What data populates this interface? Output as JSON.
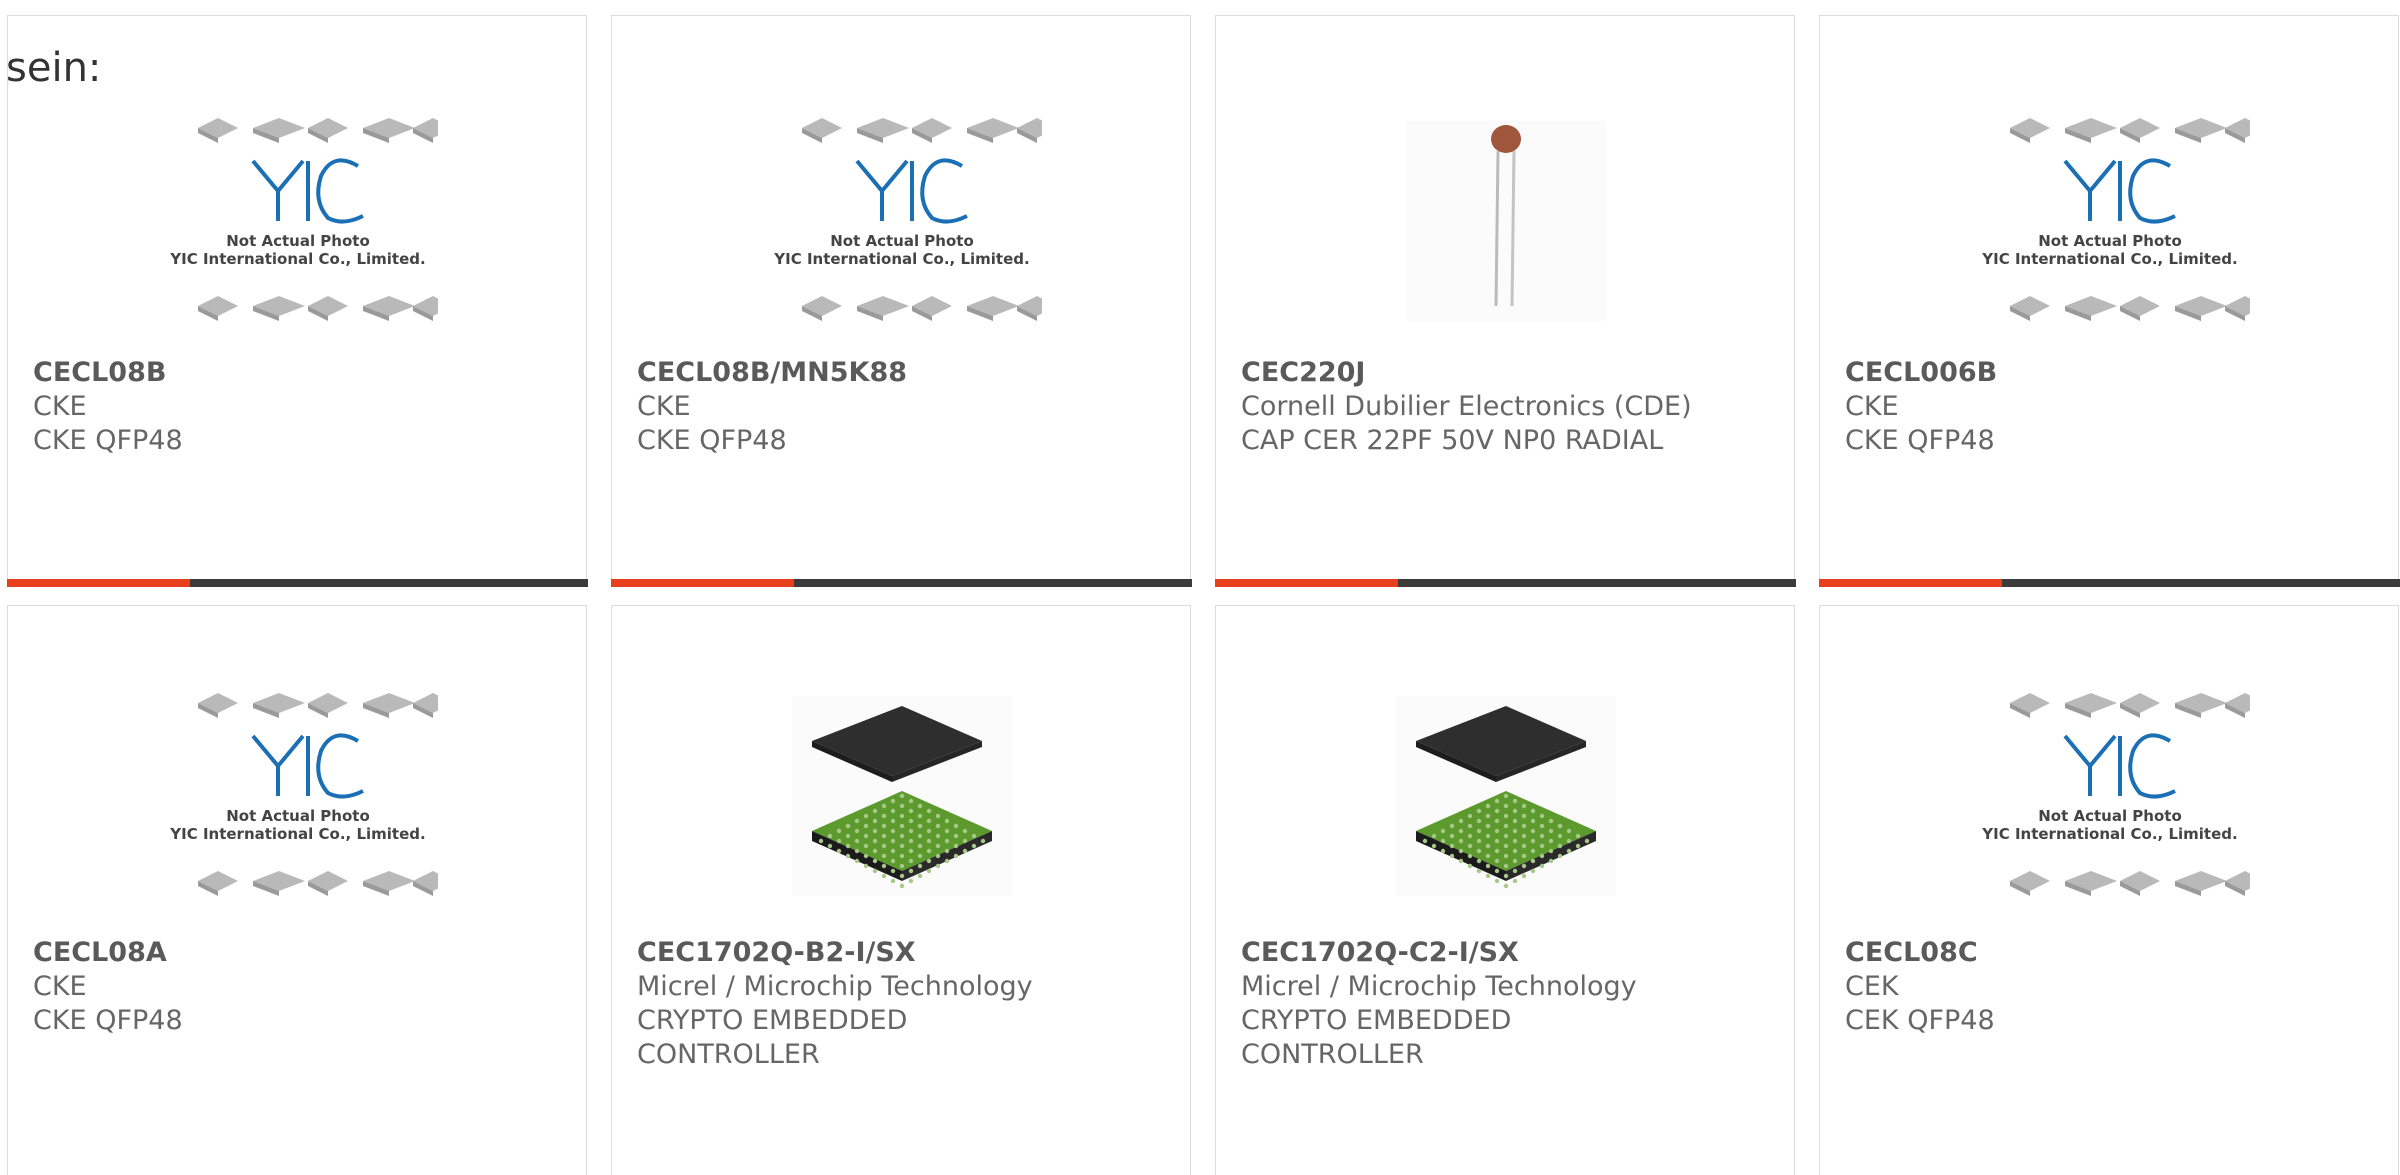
{
  "intro_text": "sein:",
  "colors": {
    "accent": "#e8401c",
    "bar": "#3b3b3b",
    "border": "#dcdcdc",
    "text": "#666666",
    "yic_blue": "#1a6fb5",
    "chip_green": "#5d9a2e"
  },
  "placeholder": {
    "line1": "Not Actual Photo",
    "line2": "YIC International Co., Limited."
  },
  "products": [
    {
      "part_number": "CECL08B",
      "manufacturer": "CKE",
      "description": "CKE QFP48",
      "image": "yic-placeholder"
    },
    {
      "part_number": "CECL08B/MN5K88",
      "manufacturer": "CKE",
      "description": "CKE QFP48",
      "image": "yic-placeholder"
    },
    {
      "part_number": "CEC220J",
      "manufacturer": "Cornell Dubilier Electronics (CDE)",
      "description": "CAP CER 22PF 50V NP0 RADIAL",
      "image": "ceramic-capacitor"
    },
    {
      "part_number": "CECL006B",
      "manufacturer": "CKE",
      "description": "CKE QFP48",
      "image": "yic-placeholder"
    },
    {
      "part_number": "CECL08A",
      "manufacturer": "CKE",
      "description": "CKE QFP48",
      "image": "yic-placeholder"
    },
    {
      "part_number": "CEC1702Q-B2-I/SX",
      "manufacturer": "Micrel / Microchip Technology",
      "description": "CRYPTO EMBEDDED CONTROLLER",
      "image": "bga-chip"
    },
    {
      "part_number": "CEC1702Q-C2-I/SX",
      "manufacturer": "Micrel / Microchip Technology",
      "description": "CRYPTO EMBEDDED CONTROLLER",
      "image": "bga-chip"
    },
    {
      "part_number": "CECL08C",
      "manufacturer": "CEK",
      "description": "CEK QFP48",
      "image": "yic-placeholder"
    }
  ]
}
